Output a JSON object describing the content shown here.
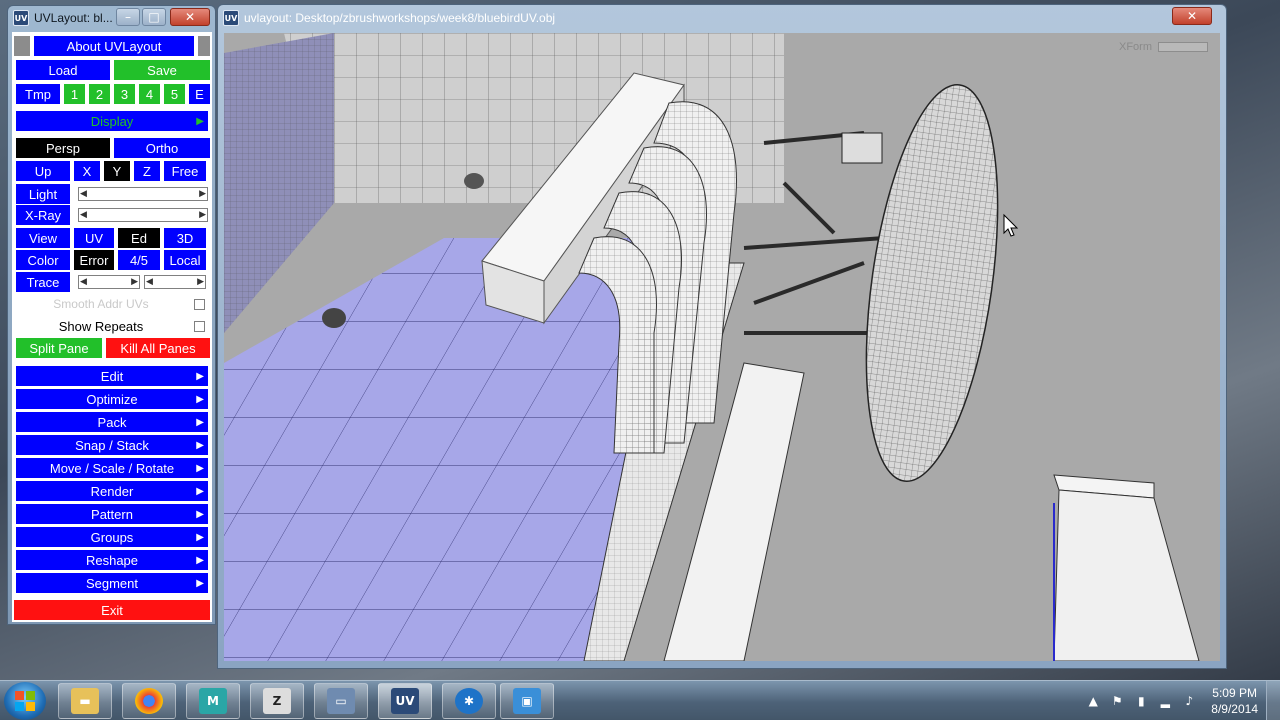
{
  "tool_window": {
    "title": "UVLayout: bl...",
    "icon": "UV",
    "about_label": "About UVLayout",
    "load_label": "Load",
    "save_label": "Save",
    "tmp_label": "Tmp",
    "tmp_slots": [
      "1",
      "2",
      "3",
      "4",
      "5",
      "E"
    ],
    "display_label": "Display",
    "persp_label": "Persp",
    "ortho_label": "Ortho",
    "up_label": "Up",
    "axes": [
      "X",
      "Y",
      "Z",
      "Free"
    ],
    "light_label": "Light",
    "xray_label": "X-Ray",
    "view_label": "View",
    "view_modes": [
      "UV",
      "Ed",
      "3D"
    ],
    "color_label": "Color",
    "color_modes": [
      "Error",
      "4/5",
      "Local"
    ],
    "trace_label": "Trace",
    "smooth_label": "Smooth Addr UVs",
    "show_repeats_label": "Show Repeats",
    "split_pane_label": "Split Pane",
    "kill_panes_label": "Kill All Panes",
    "menu_items": [
      "Edit",
      "Optimize",
      "Pack",
      "Snap / Stack",
      "Move / Scale / Rotate",
      "Render",
      "Pattern",
      "Groups",
      "Reshape",
      "Segment"
    ],
    "exit_label": "Exit"
  },
  "view_window": {
    "title": "uvlayout: Desktop/zbrushworkshops/week8/bluebirdUV.obj",
    "xform_label": "XForm"
  },
  "taskbar": {
    "apps": [
      "explorer",
      "chrome",
      "maya",
      "zbrush",
      "photoshop",
      "uvlayout",
      "settings",
      "remote"
    ],
    "uv_label": "UV",
    "time": "5:09 PM",
    "date": "8/9/2014"
  }
}
